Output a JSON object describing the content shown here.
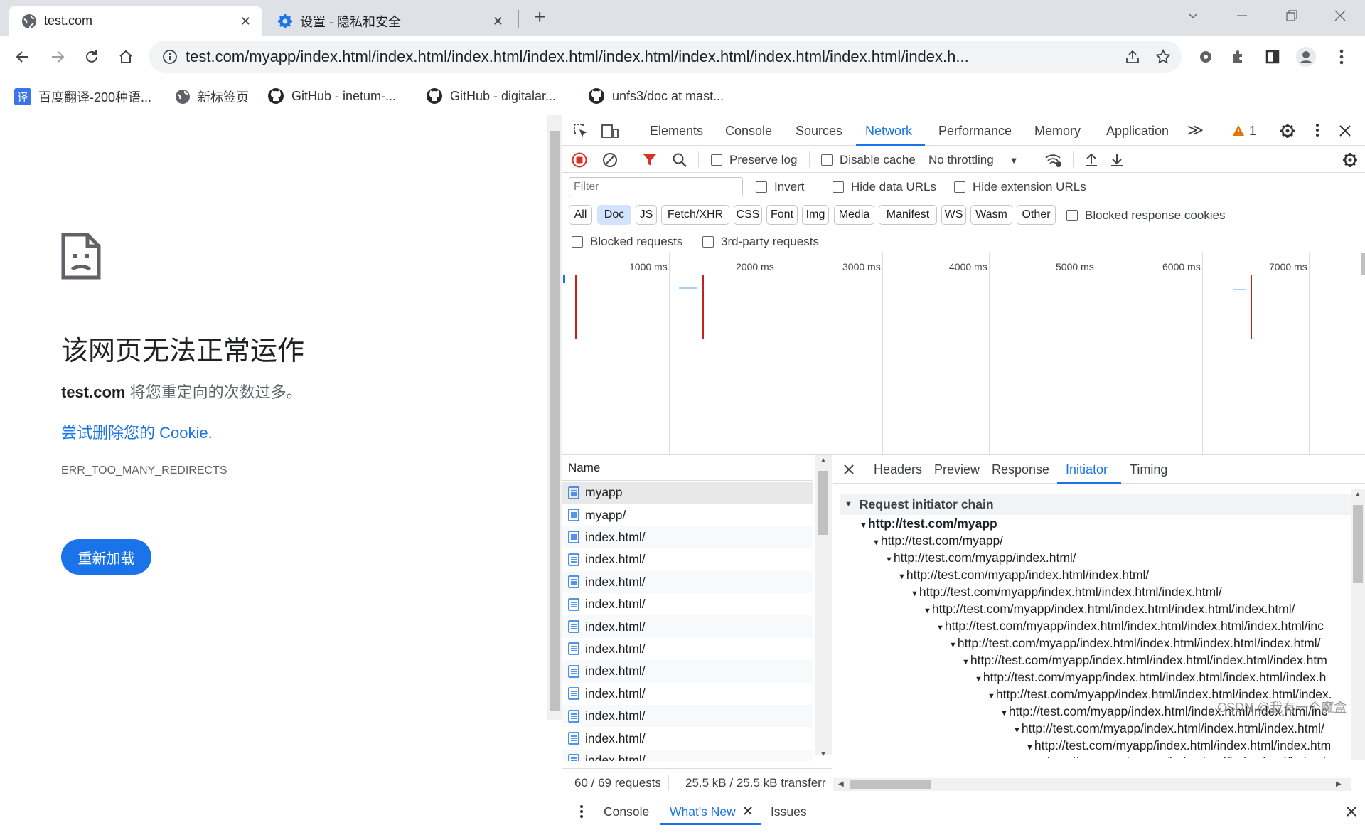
{
  "tabs": [
    {
      "title": "test.com",
      "close": "✕"
    },
    {
      "title": "设置 - 隐私和安全",
      "close": "✕"
    }
  ],
  "new_tab": "+",
  "omnibox": {
    "url": "test.com/myapp/index.html/index.html/index.html/index.html/index.html/index.html/index.html/index.html/index.h..."
  },
  "bookmarks": [
    {
      "label": "百度翻译-200种语...",
      "icon": "translate-icon"
    },
    {
      "label": "新标签页",
      "icon": "globe-icon"
    },
    {
      "label": "GitHub - inetum-...",
      "icon": "github-icon"
    },
    {
      "label": "GitHub - digitalar...",
      "icon": "github-icon"
    },
    {
      "label": "unfs3/doc at mast...",
      "icon": "github-icon"
    }
  ],
  "error_page": {
    "heading": "该网页无法正常运作",
    "host": "test.com",
    "message": " 将您重定向的次数过多。",
    "link": "尝试删除您的 Cookie.",
    "code": "ERR_TOO_MANY_REDIRECTS",
    "reload": "重新加载"
  },
  "devtools": {
    "tabs": [
      "Elements",
      "Console",
      "Sources",
      "Network",
      "Performance",
      "Memory",
      "Application"
    ],
    "active_tab": "Network",
    "more": "≫",
    "warnings": "1",
    "preserve_log": "Preserve log",
    "disable_cache": "Disable cache",
    "throttling": "No throttling",
    "filter_placeholder": "Filter",
    "invert": "Invert",
    "hide_data_urls": "Hide data URLs",
    "hide_extension_urls": "Hide extension URLs",
    "type_filters": [
      "All",
      "Doc",
      "JS",
      "Fetch/XHR",
      "CSS",
      "Font",
      "Img",
      "Media",
      "Manifest",
      "WS",
      "Wasm",
      "Other"
    ],
    "active_filter": "Doc",
    "blocked_response_cookies": "Blocked response cookies",
    "blocked_requests": "Blocked requests",
    "third_party": "3rd-party requests",
    "timeline_ticks": [
      "1000 ms",
      "2000 ms",
      "3000 ms",
      "4000 ms",
      "5000 ms",
      "6000 ms",
      "7000 ms"
    ],
    "name_header": "Name",
    "requests": [
      "myapp",
      "myapp/",
      "index.html/",
      "index.html/",
      "index.html/",
      "index.html/",
      "index.html/",
      "index.html/",
      "index.html/",
      "index.html/",
      "index.html/",
      "index.html/",
      "index.html/"
    ],
    "status_requests": "60 / 69 requests",
    "status_transfer": "25.5 kB / 25.5 kB transferr",
    "detail_tabs": [
      "Headers",
      "Preview",
      "Response",
      "Initiator",
      "Timing"
    ],
    "active_detail": "Initiator",
    "chain_title": "Request initiator chain",
    "chain": [
      "http://test.com/myapp",
      "http://test.com/myapp/",
      "http://test.com/myapp/index.html/",
      "http://test.com/myapp/index.html/index.html/",
      "http://test.com/myapp/index.html/index.html/index.html/",
      "http://test.com/myapp/index.html/index.html/index.html/index.html/",
      "http://test.com/myapp/index.html/index.html/index.html/index.html/inc",
      "http://test.com/myapp/index.html/index.html/index.html/index.html/",
      "http://test.com/myapp/index.html/index.html/index.html/index.htm",
      "http://test.com/myapp/index.html/index.html/index.html/index.h",
      "http://test.com/myapp/index.html/index.html/index.html/index.",
      "http://test.com/myapp/index.html/index.html/index.html/inc",
      "http://test.com/myapp/index.html/index.html/index.html/",
      "http://test.com/myapp/index.html/index.html/index.htm",
      "http://test.com/myapp/index.html/index.html/index.h"
    ],
    "drawer_tabs": [
      "Console",
      "What's New",
      "Issues"
    ],
    "active_drawer": "What's New"
  },
  "watermark": "CSDN @我有一个魔盒"
}
